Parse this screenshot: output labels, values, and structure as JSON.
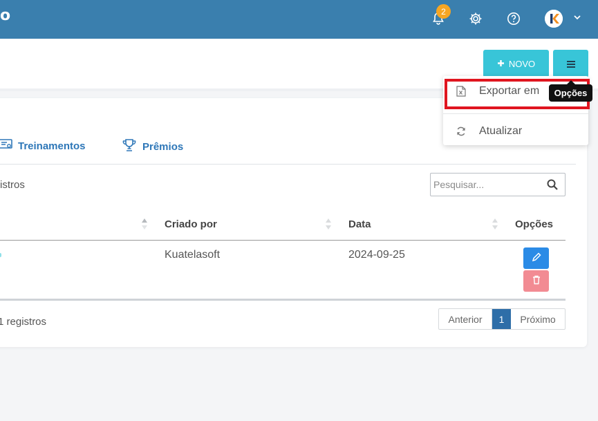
{
  "header": {
    "brand_fragment": "o",
    "notification_count": "2",
    "icons": [
      "bell-icon",
      "gear-icon",
      "help-icon",
      "chevron-down-icon"
    ],
    "colors": {
      "topbar": "#3a7fae",
      "badge": "#f6a623",
      "accent_button": "#38c5d8"
    }
  },
  "toolbar": {
    "new_label": "NOVO"
  },
  "dropdown": {
    "export_label": "Exportar em",
    "refresh_label": "Atualizar"
  },
  "tooltip": {
    "text": "Opções"
  },
  "tabs": [
    {
      "label": "Treinamentos",
      "icon": "certificate-icon"
    },
    {
      "label": "Prêmios",
      "icon": "trophy-icon"
    }
  ],
  "table": {
    "length_text_fragment": "istros",
    "search_placeholder": "Pesquisar...",
    "columns": [
      "Criado por",
      "Data",
      "Opções"
    ],
    "rows": [
      {
        "created_by": "Kuatelasoft",
        "date": "2024-09-25"
      }
    ],
    "info_text_fragment": "1 registros"
  },
  "pagination": {
    "prev_label": "Anterior",
    "current_page": "1",
    "next_label": "Próximo"
  }
}
